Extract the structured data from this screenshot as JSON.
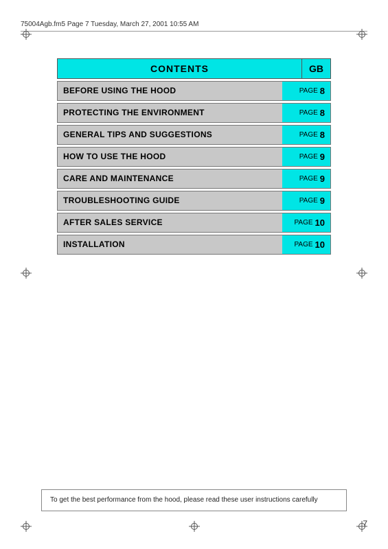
{
  "header": {
    "text": "75004Agb.fm5  Page 7  Tuesday, March 27, 2001  10:55 AM"
  },
  "contents": {
    "title": "CONTENTS",
    "gb_label": "GB"
  },
  "toc_items": [
    {
      "label": "BEFORE USING THE HOOD",
      "page_word": "PAGE",
      "page_num": "8"
    },
    {
      "label": "PROTECTING THE ENVIRONMENT",
      "page_word": "PAGE",
      "page_num": "8"
    },
    {
      "label": "GENERAL TIPS AND SUGGESTIONS",
      "page_word": "PAGE",
      "page_num": "8"
    },
    {
      "label": "HOW TO USE THE HOOD",
      "page_word": "PAGE",
      "page_num": "9"
    },
    {
      "label": "CARE AND MAINTENANCE",
      "page_word": "PAGE",
      "page_num": "9"
    },
    {
      "label": "TROUBLESHOOTING GUIDE",
      "page_word": "PAGE",
      "page_num": "9"
    },
    {
      "label": "AFTER SALES SERVICE",
      "page_word": "PAGE",
      "page_num": "10"
    },
    {
      "label": "INSTALLATION",
      "page_word": "PAGE",
      "page_num": "10"
    }
  ],
  "bottom_note": "To get the best performance from the hood, please read these user instructions carefully",
  "page_number": "7"
}
